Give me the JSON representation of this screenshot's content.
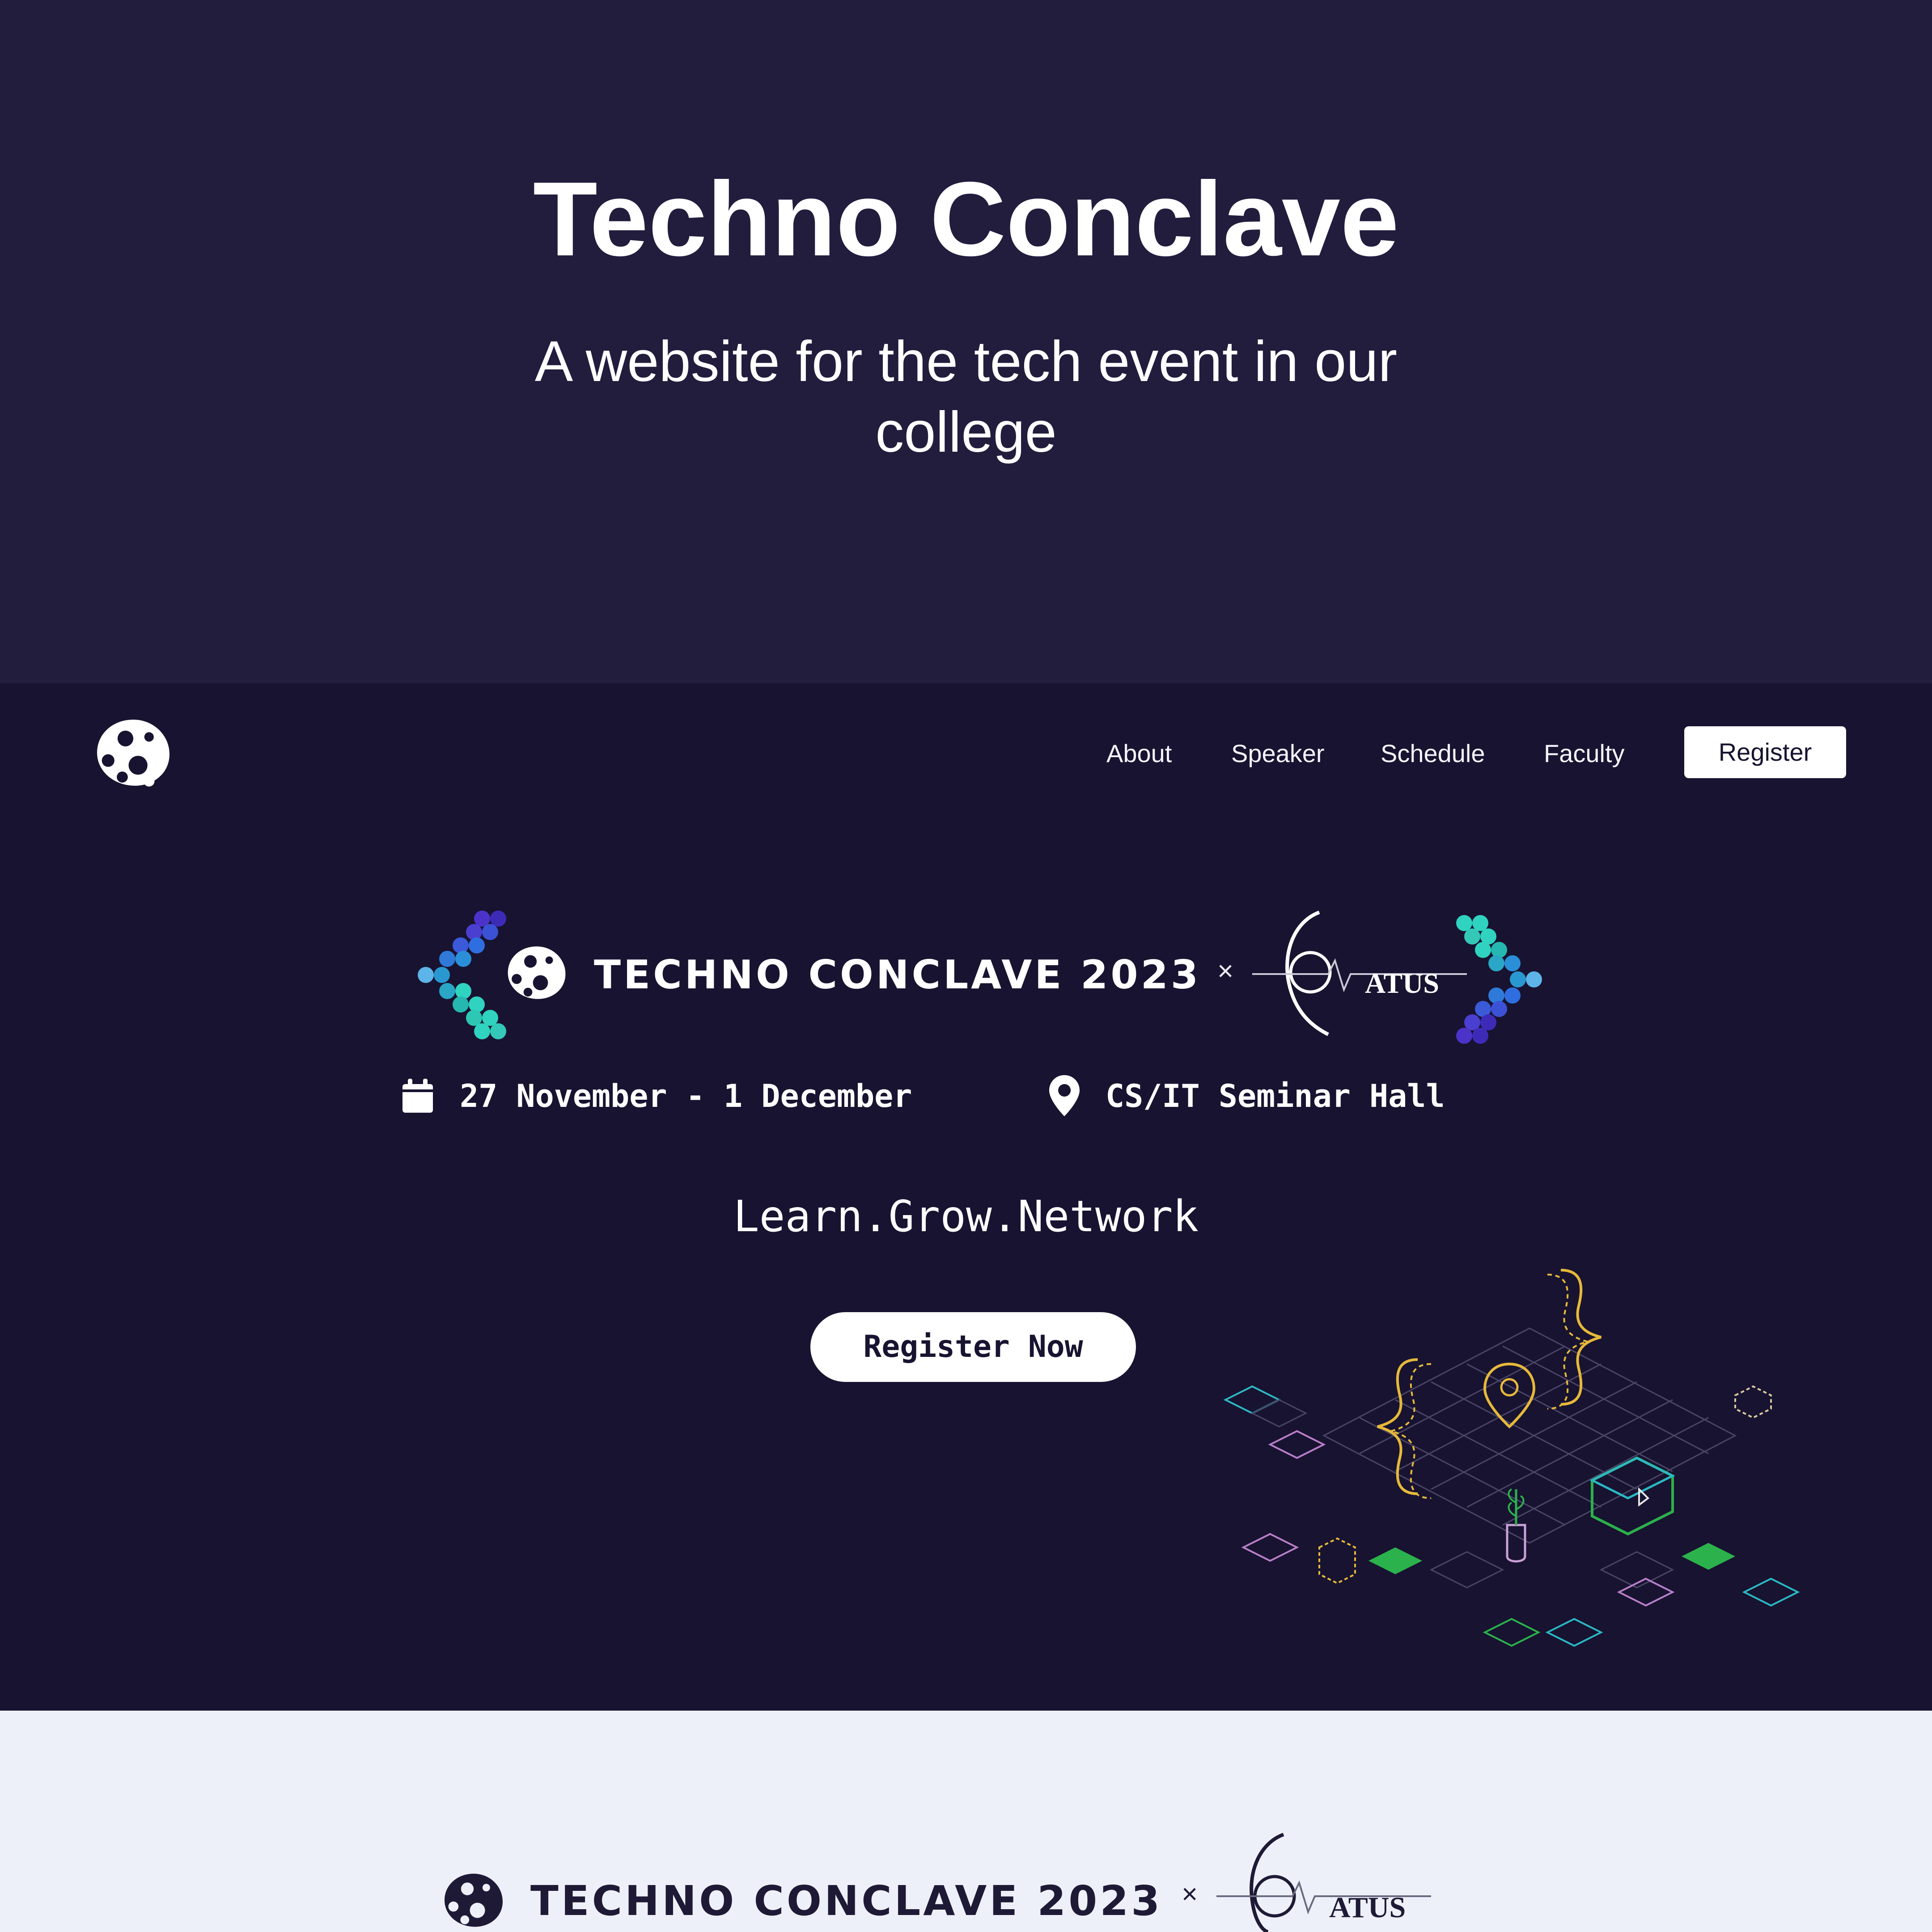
{
  "intro": {
    "title": "Techno Conclave",
    "subtitle": "A website for the tech event in our college"
  },
  "nav": {
    "items": [
      {
        "label": "About"
      },
      {
        "label": "Speaker"
      },
      {
        "label": "Schedule"
      },
      {
        "label": "Faculty"
      }
    ],
    "register_label": "Register"
  },
  "hero": {
    "event_title": "TECHNO CONCLAVE 2023",
    "collab_symbol": "×",
    "partner_name": "ATUS",
    "date": "27 November - 1 December",
    "venue": "CS/IT Seminar Hall",
    "tagline": "Learn.Grow.Network",
    "cta_label": "Register Now"
  },
  "footer": {
    "event_title": "TECHNO CONCLAVE 2023",
    "collab_symbol": "×",
    "partner_name": "ATUS"
  },
  "colors": {
    "intro_bg": "#221c3d",
    "hero_bg": "#181330",
    "footer_bg": "#eef0f9",
    "accent_teal": "#2fd3c0",
    "accent_purple": "#4b33c9",
    "accent_yellow": "#e6b93a",
    "accent_green": "#2bb24c"
  },
  "icons": [
    "community-logo-icon",
    "calendar-icon",
    "map-pin-icon",
    "pixel-left-chevron-icon",
    "pixel-right-chevron-icon"
  ]
}
